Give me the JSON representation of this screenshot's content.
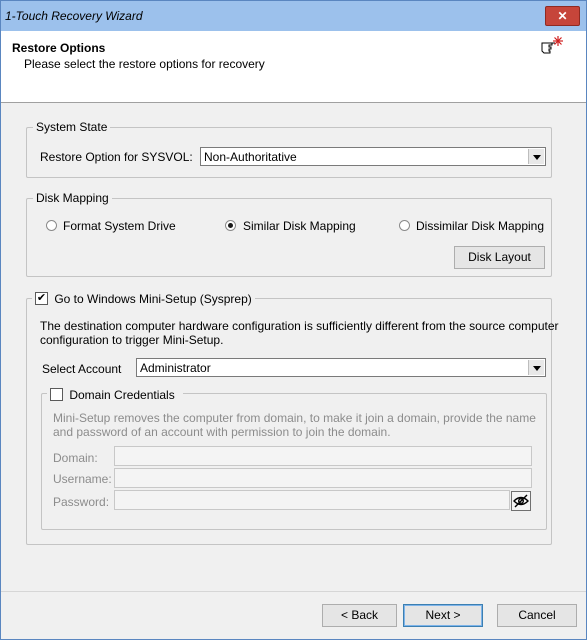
{
  "window": {
    "title": "1-Touch Recovery Wizard",
    "close_glyph": "✕"
  },
  "header": {
    "title": "Restore Options",
    "subtitle": "Please select the restore options for recovery",
    "icon": "pointing-hand-icon"
  },
  "system_state": {
    "legend": "System State",
    "sysvol_label": "Restore Option for SYSVOL:",
    "sysvol_value": "Non-Authoritative"
  },
  "disk_mapping": {
    "legend": "Disk Mapping",
    "options": [
      {
        "label": "Format System Drive",
        "selected": false
      },
      {
        "label": "Similar Disk Mapping",
        "selected": true
      },
      {
        "label": "Dissimilar Disk Mapping",
        "selected": false
      }
    ],
    "disk_layout_button": "Disk Layout"
  },
  "mini_setup": {
    "legend": "Go to Windows Mini-Setup (Sysprep)",
    "checked": true,
    "description_line1": "The destination computer hardware configuration is sufficiently different from the source computer",
    "description_line2": "configuration to trigger Mini-Setup.",
    "account_label": "Select Account",
    "account_value": "Administrator",
    "domain": {
      "legend": "Domain Credentials",
      "checked": false,
      "help_line1": "Mini-Setup removes the computer from domain, to make it join a domain, provide the name",
      "help_line2": "and password of an account with permission to join the domain.",
      "domain_label": "Domain:",
      "username_label": "Username:",
      "password_label": "Password:"
    }
  },
  "footer": {
    "back": "< Back",
    "next": "Next >",
    "cancel": "Cancel"
  }
}
